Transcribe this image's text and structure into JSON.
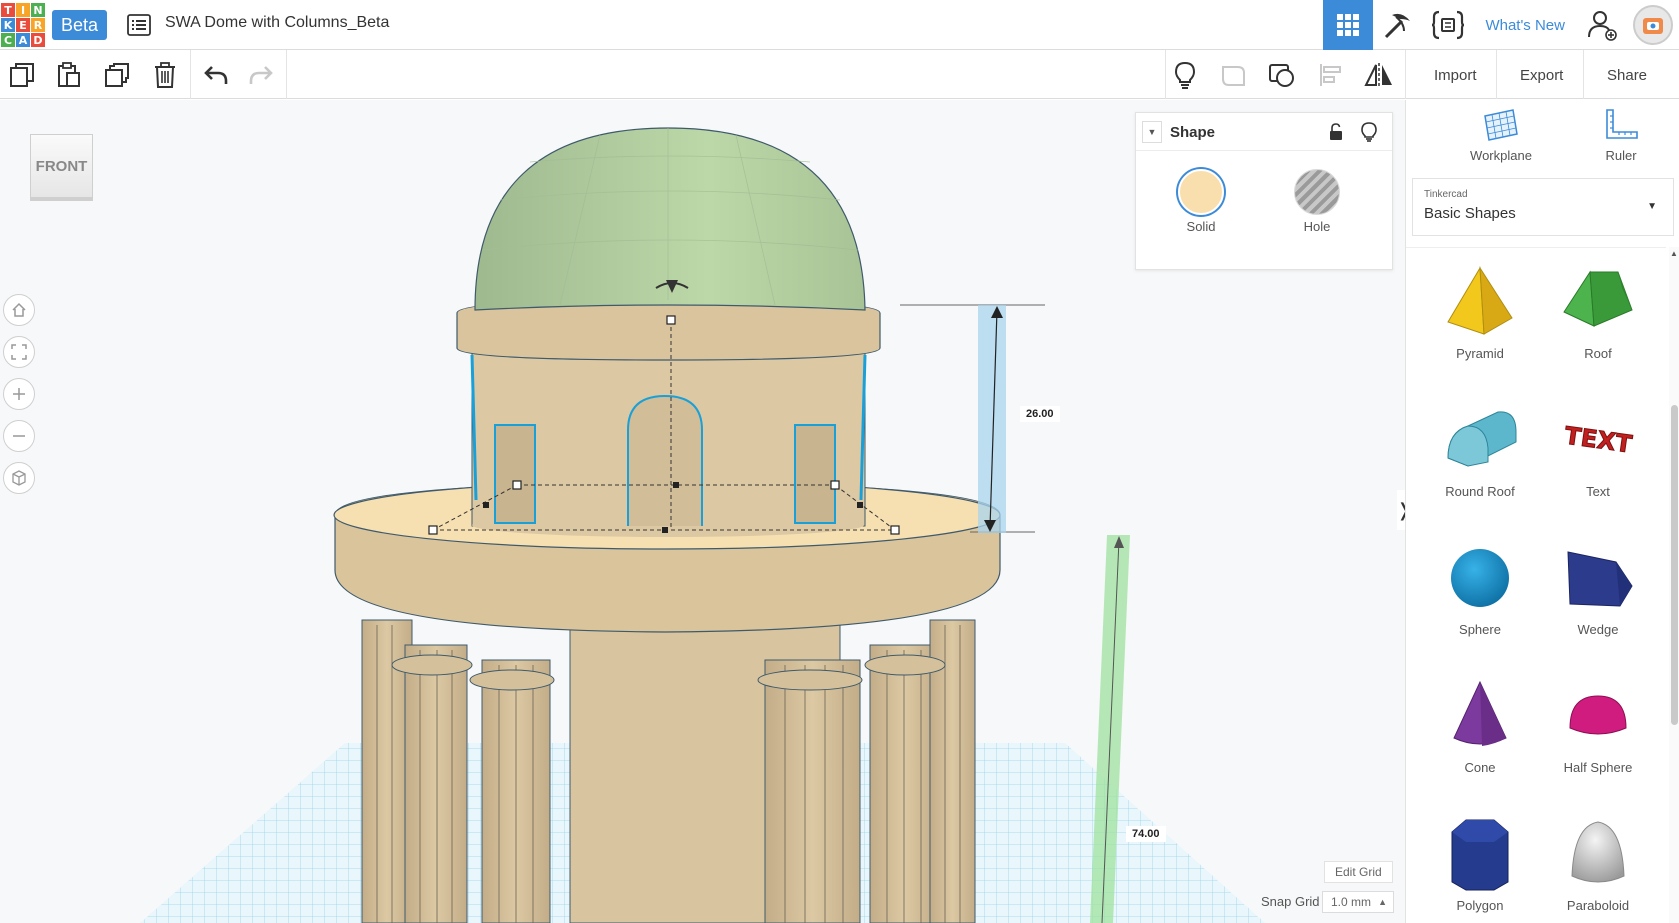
{
  "app": {
    "logo_letters": [
      "T",
      "I",
      "N",
      "K",
      "E",
      "R",
      "C",
      "A",
      "D"
    ],
    "logo_colors": [
      "#e94b3c",
      "#f7a428",
      "#4caf50",
      "#3c8bd9",
      "#e94b3c",
      "#f7a428",
      "#4caf50",
      "#3c8bd9",
      "#e94b3c"
    ],
    "beta_label": "Beta",
    "design_title": "SWA Dome with Columns_Beta",
    "whats_new": "What's New",
    "accent": "#3c8bd9"
  },
  "toolbar": {
    "import_label": "Import",
    "export_label": "Export",
    "share_label": "Share"
  },
  "viewport": {
    "viewcube_label": "FRONT",
    "height_dimension": "26.00",
    "depth_dimension": "74.00",
    "edit_grid_label": "Edit Grid",
    "snap_grid_label": "Snap Grid",
    "snap_grid_value": "1.0 mm"
  },
  "shape_panel": {
    "title": "Shape",
    "solid_label": "Solid",
    "hole_label": "Hole",
    "solid_color": "#f9dfae"
  },
  "sidebar": {
    "workplane_label": "Workplane",
    "ruler_label": "Ruler",
    "library_brand": "Tinkercad",
    "library_name": "Basic Shapes",
    "shapes": [
      {
        "name": "Pyramid",
        "icon": "pyramid-icon"
      },
      {
        "name": "Roof",
        "icon": "roof-icon"
      },
      {
        "name": "Round Roof",
        "icon": "round-roof-icon"
      },
      {
        "name": "Text",
        "icon": "text-shape-icon"
      },
      {
        "name": "Sphere",
        "icon": "sphere-icon"
      },
      {
        "name": "Wedge",
        "icon": "wedge-icon"
      },
      {
        "name": "Cone",
        "icon": "cone-icon"
      },
      {
        "name": "Half Sphere",
        "icon": "half-sphere-icon"
      },
      {
        "name": "Polygon",
        "icon": "polygon-icon"
      },
      {
        "name": "Paraboloid",
        "icon": "paraboloid-icon"
      }
    ],
    "text_shape_glyph": "TEXT"
  }
}
